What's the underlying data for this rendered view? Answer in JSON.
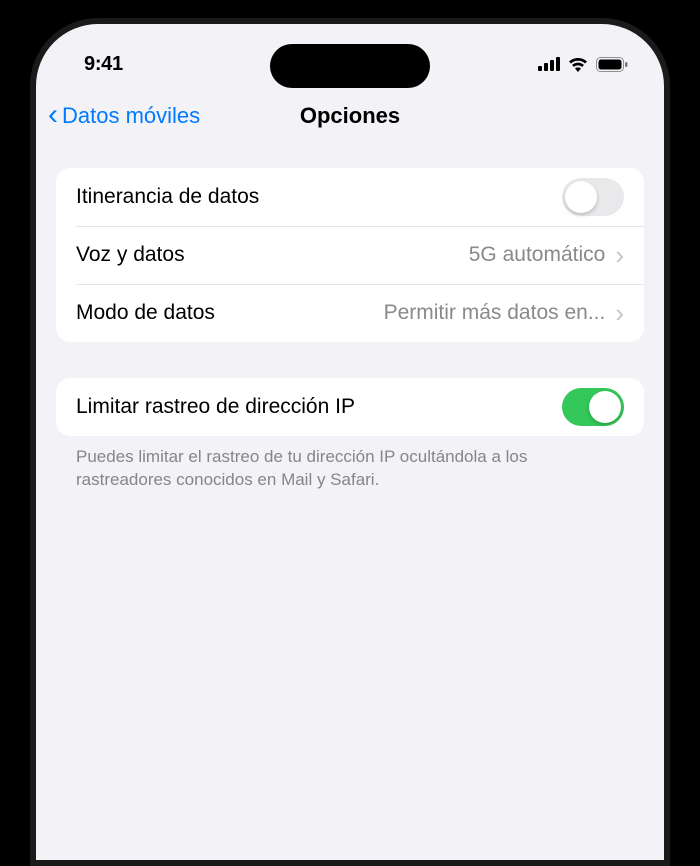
{
  "status": {
    "time": "9:41"
  },
  "nav": {
    "back_label": "Datos móviles",
    "title": "Opciones"
  },
  "group1": {
    "roaming": {
      "label": "Itinerancia de datos",
      "on": false
    },
    "voice_data": {
      "label": "Voz y datos",
      "value": "5G automático"
    },
    "data_mode": {
      "label": "Modo de datos",
      "value": "Permitir más datos en..."
    }
  },
  "group2": {
    "limit_ip": {
      "label": "Limitar rastreo de dirección IP",
      "on": true
    },
    "footer": "Puedes limitar el rastreo de tu dirección IP ocultándola a los rastreadores conocidos en Mail y Safari."
  }
}
